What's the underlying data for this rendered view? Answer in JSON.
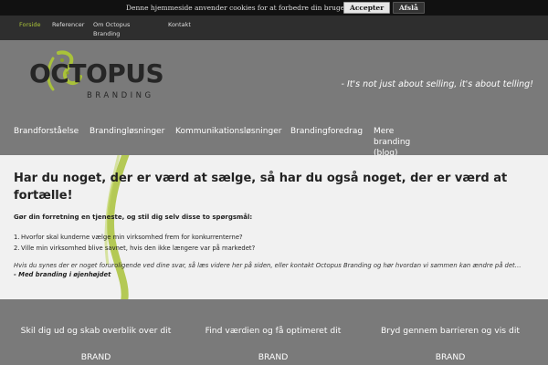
{
  "cookie": {
    "text": "Denne hjemmeside anvender cookies for at forbedre din brugeroplevelse",
    "accept_label": "Accepter",
    "close_label": "Afslå"
  },
  "topnav": {
    "items": [
      "Forside",
      "Referencer",
      "Om Octopus Branding",
      "Kontakt"
    ],
    "active": "Forside"
  },
  "header": {
    "logo_word": "OCTOPUS",
    "logo_sub": "BRANDING",
    "tagline": "- It's not just about selling, it's about telling!"
  },
  "mainnav": {
    "items": [
      "Brandforståelse",
      "Brandingløsninger",
      "Kommunikationsløsninger",
      "Brandingforedrag",
      "Mere branding (blog)"
    ]
  },
  "content": {
    "headline": "Har du noget, der er værd at sælge, så har du også noget, der er værd at fortælle!",
    "subhead": "Gør din forretning en tjeneste, og stil dig selv disse to spørgsmål:",
    "questions": [
      "Hvorfor skal kunderne vælge min virksomhed frem for konkurrenterne?",
      "Ville min virksomhed blive savnet, hvis den ikke længere var på markedet?"
    ],
    "note": "Hvis du synes der er noget foruroligende ved dine svar, så læs videre her på siden, eller kontakt Octopus Branding og hør hvordan vi sammen kan ændre på det…",
    "signature": "- Med branding i øjenhøjdet"
  },
  "features": [
    "Skil dig ud og skab overblik over dit BRAND",
    "Find værdien og få optimeret dit BRAND",
    "Bryd gennem barrieren og vis dit BRAND"
  ],
  "colors": {
    "accent": "#a9c23a",
    "dark_bar": "#111111",
    "nav_bar": "#2e2e2e",
    "header_bg": "#7a7a7a",
    "content_bg": "#f1f1f1"
  }
}
